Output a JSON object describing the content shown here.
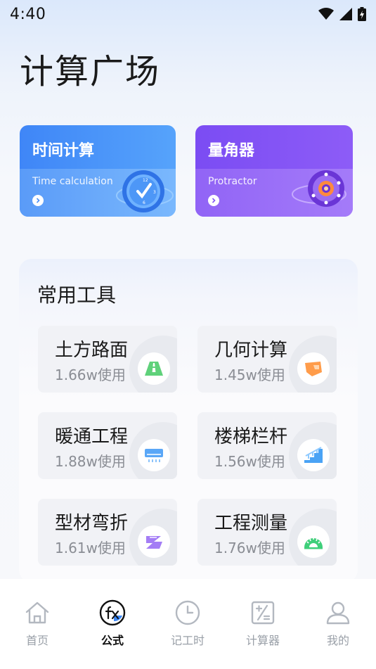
{
  "status_bar": {
    "time": "4:40"
  },
  "page": {
    "title": "计算广场"
  },
  "feature_cards": [
    {
      "title": "时间计算",
      "subtitle": "Time calculation",
      "icon": "clock-icon",
      "color_start": "#3f86f7",
      "color_end": "#56a3fb"
    },
    {
      "title": "量角器",
      "subtitle": "Protractor",
      "icon": "protractor-icon",
      "color_start": "#7b4cf3",
      "color_end": "#8d5cf7"
    }
  ],
  "tools": {
    "title": "常用工具",
    "items": [
      {
        "name": "土方路面",
        "usage": "1.66w使用",
        "icon": "road-icon"
      },
      {
        "name": "几何计算",
        "usage": "1.45w使用",
        "icon": "geometry-icon"
      },
      {
        "name": "暖通工程",
        "usage": "1.88w使用",
        "icon": "air-conditioner-icon"
      },
      {
        "name": "楼梯栏杆",
        "usage": "1.56w使用",
        "icon": "stairs-icon"
      },
      {
        "name": "型材弯折",
        "usage": "1.61w使用",
        "icon": "profile-bend-icon"
      },
      {
        "name": "工程测量",
        "usage": "1.76w使用",
        "icon": "survey-ruler-icon"
      }
    ]
  },
  "tab_bar": {
    "items": [
      {
        "label": "首页",
        "icon": "home-icon",
        "active": false
      },
      {
        "label": "公式",
        "icon": "formula-fx-icon",
        "active": true
      },
      {
        "label": "记工时",
        "icon": "clock-icon",
        "active": false
      },
      {
        "label": "计算器",
        "icon": "calculator-icon",
        "active": false
      },
      {
        "label": "我的",
        "icon": "user-icon",
        "active": false
      }
    ]
  }
}
